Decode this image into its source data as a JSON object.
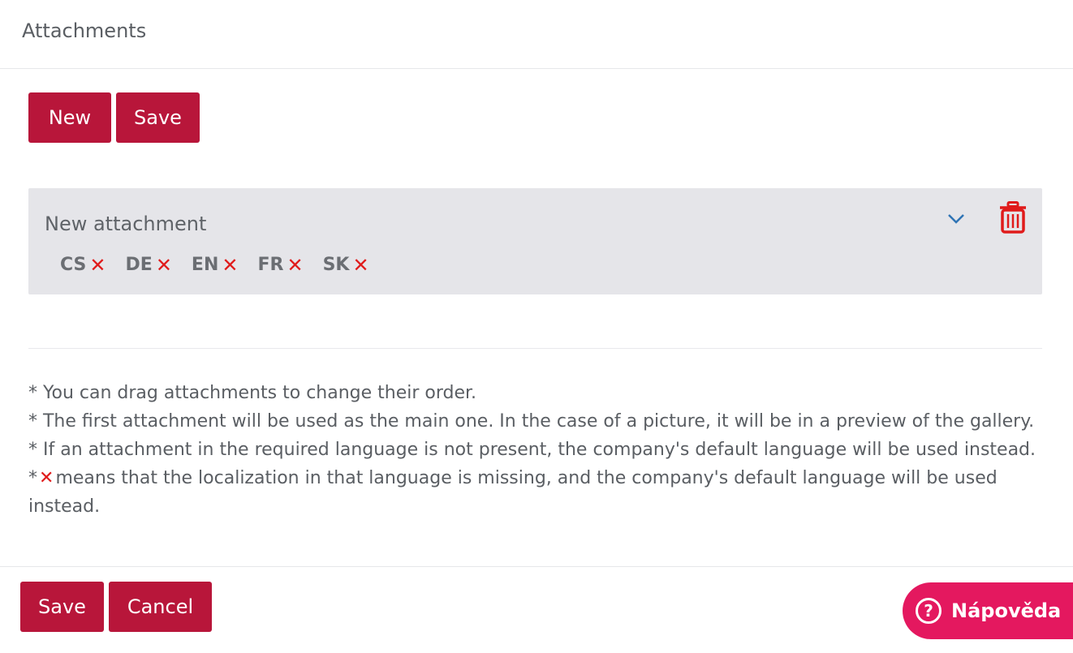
{
  "header": {
    "title": "Attachments"
  },
  "toolbar": {
    "new_label": "New",
    "save_label": "Save"
  },
  "attachment": {
    "title": "New attachment",
    "languages": [
      {
        "code": "CS",
        "status": "missing"
      },
      {
        "code": "DE",
        "status": "missing"
      },
      {
        "code": "EN",
        "status": "missing"
      },
      {
        "code": "FR",
        "status": "missing"
      },
      {
        "code": "SK",
        "status": "missing"
      }
    ],
    "expand_icon": "chevron-down-icon",
    "delete_icon": "trash-icon"
  },
  "notes": {
    "line1": "* You can drag attachments to change their order.",
    "line2": "* The first attachment will be used as the main one. In the case of a picture, it will be in a preview of the gallery.",
    "line3": "* If an attachment in the required language is not present, the company's default language will be used instead.",
    "line4_prefix": "*",
    "line4_rest": "means that the localization in that language is missing, and the company's default language will be used instead."
  },
  "footer": {
    "save_label": "Save",
    "cancel_label": "Cancel"
  },
  "help": {
    "label": "Nápověda",
    "icon": "question-icon"
  },
  "colors": {
    "primary": "#b8163a",
    "help": "#e4185f",
    "missing": "#e01b1b",
    "card": "#e5e5e9",
    "chevron": "#2f74b5"
  }
}
